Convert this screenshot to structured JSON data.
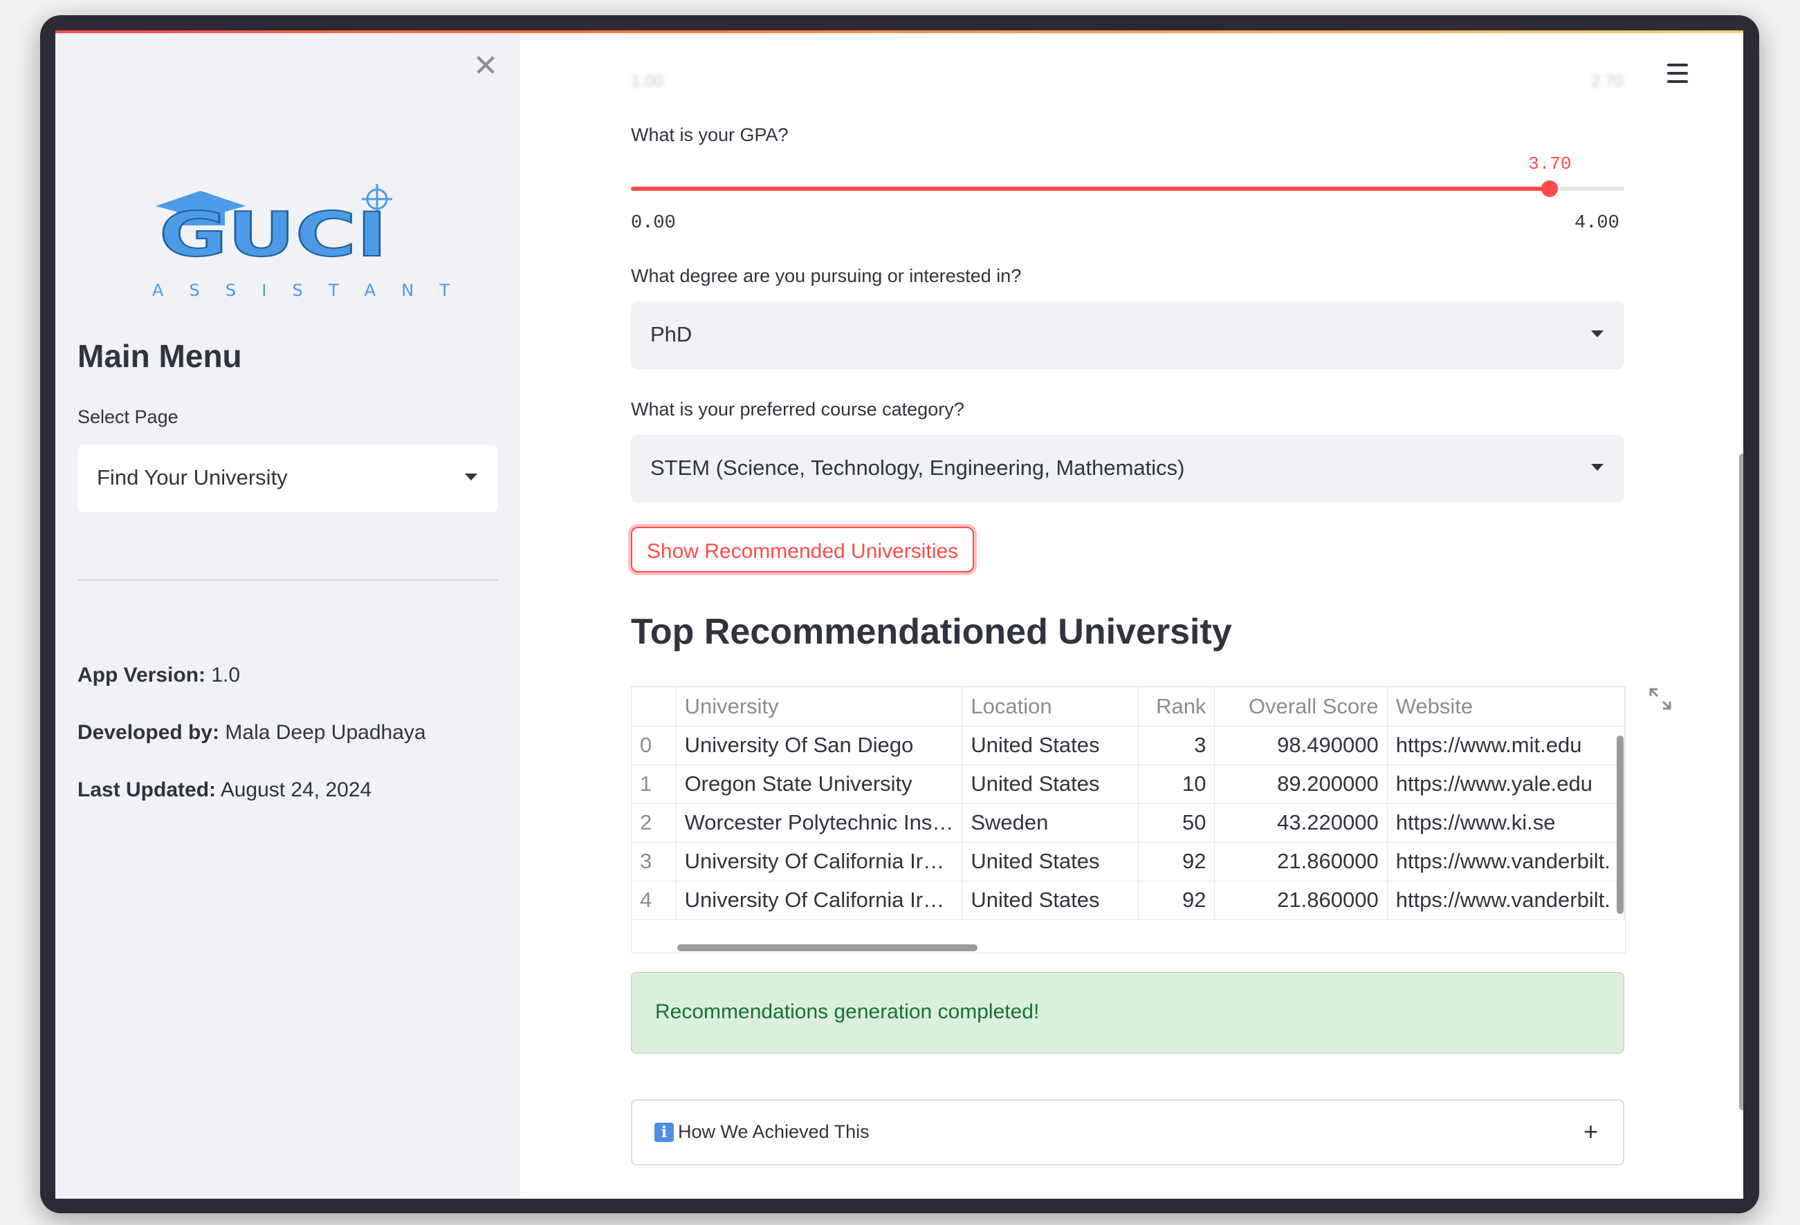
{
  "sidebar": {
    "logo_text": "GUCI",
    "logo_subtext": "A S S I S T A N T",
    "menu_title": "Main Menu",
    "select_label": "Select Page",
    "select_value": "Find Your University",
    "app_version_label": "App Version:",
    "app_version_value": " 1.0",
    "developed_by_label": "Developed by:",
    "developed_by_value": " Mala Deep Upadhaya",
    "last_updated_label": "Last Updated:",
    "last_updated_value": " August 24, 2024"
  },
  "form": {
    "prev_slider_min": "1.00",
    "prev_slider_max": "2.70",
    "gpa_label": "What is your GPA?",
    "gpa_value": "3.70",
    "gpa_min": "0.00",
    "gpa_max": "4.00",
    "gpa_fraction": 0.925,
    "degree_label": "What degree are you pursuing or interested in?",
    "degree_value": "PhD",
    "course_label": "What is your preferred course category?",
    "course_value": "STEM (Science, Technology, Engineering, Mathematics)",
    "button_label": "Show Recommended Universities"
  },
  "results": {
    "title": "Top Recommendationed University",
    "columns": [
      "",
      "University",
      "Location",
      "Rank",
      "Overall Score",
      "Website"
    ],
    "rows": [
      [
        "0",
        "University Of San Diego",
        "United States",
        "3",
        "98.490000",
        "https://www.mit.edu"
      ],
      [
        "1",
        "Oregon State University",
        "United States",
        "10",
        "89.200000",
        "https://www.yale.edu"
      ],
      [
        "2",
        "Worcester Polytechnic Ins…",
        "Sweden",
        "50",
        "43.220000",
        "https://www.ki.se"
      ],
      [
        "3",
        "University Of California Ir…",
        "United States",
        "92",
        "21.860000",
        "https://www.vanderbilt."
      ],
      [
        "4",
        "University Of California Ir…",
        "United States",
        "92",
        "21.860000",
        "https://www.vanderbilt."
      ]
    ],
    "success_message": "Recommendations generation completed!",
    "expander_label": "How We Achieved This"
  },
  "colors": {
    "accent": "#ff4b4b",
    "success_bg": "#dbefdc",
    "success_text": "#177233",
    "logo_blue": "#4d9be6"
  }
}
